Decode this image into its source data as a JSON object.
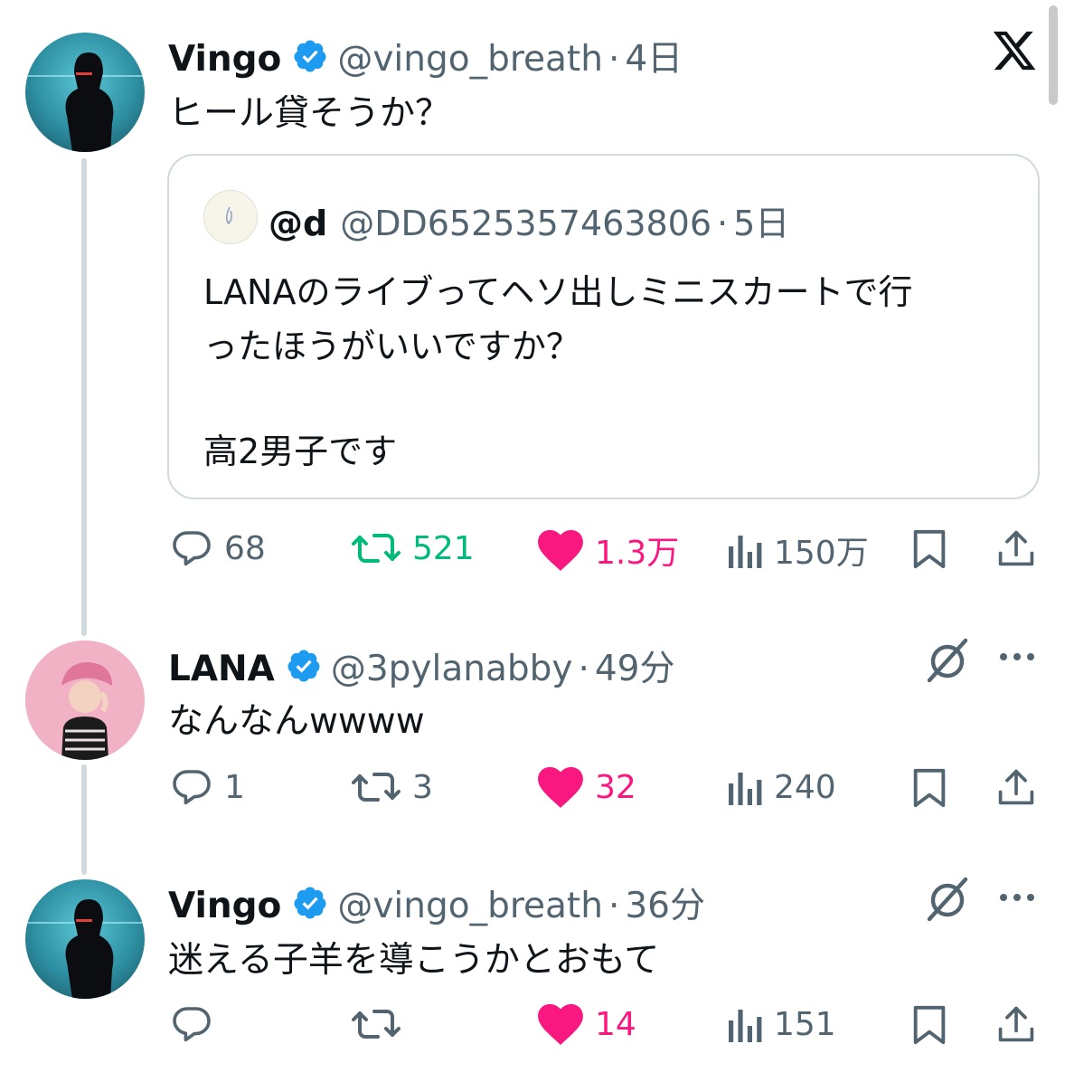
{
  "colors": {
    "accent": "#1d9bf0",
    "like": "#f91880",
    "repost": "#00ba7c",
    "muted": "#536471",
    "line": "#cfd9de"
  },
  "logo": "x-logo-icon",
  "tweets": [
    {
      "name": "Vingo",
      "handle": "@vingo_breath",
      "sep": "·",
      "time": "4日",
      "text": "ヒール貸そうか？",
      "quote": {
        "name": "@d",
        "handle": "@DD6525357463806",
        "sep": "·",
        "time": "5日",
        "lines": [
          "LANAのライブってヘソ出しミニスカートで行",
          "ったほうがいいですか？",
          "",
          "高2男子です"
        ]
      },
      "actions": {
        "replies": "68",
        "reposts": "521",
        "likes": "1.3万",
        "views": "150万"
      }
    },
    {
      "name": "LANA",
      "handle": "@3pylanabby",
      "sep": "·",
      "time": "49分",
      "text": "なんなんwwww",
      "actions": {
        "replies": "1",
        "reposts": "3",
        "likes": "32",
        "views": "240"
      }
    },
    {
      "name": "Vingo",
      "handle": "@vingo_breath",
      "sep": "·",
      "time": "36分",
      "text": "迷える子羊を導こうかとおもて",
      "actions": {
        "replies": "",
        "reposts": "",
        "likes": "14",
        "views": "151"
      }
    }
  ]
}
